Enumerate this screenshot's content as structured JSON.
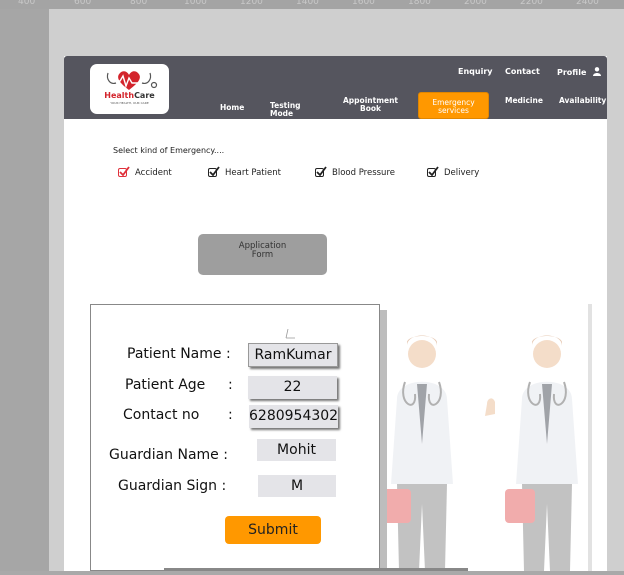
{
  "ruler": [
    "400",
    "600",
    "800",
    "1000",
    "1200",
    "1400",
    "1600",
    "1800",
    "2000",
    "2200",
    "2400"
  ],
  "logo": {
    "brand_red": "Health",
    "brand_dark": "Care",
    "tagline": "YOUR HEALTH, OUR CARE"
  },
  "nav_top": {
    "enquiry": "Enquiry",
    "contact": "Contact",
    "profile": "Profile"
  },
  "nav": {
    "home": "Home",
    "testing_1": "Testing",
    "testing_2": "Mode",
    "appointment_1": "Appointment",
    "appointment_2": "Book",
    "emergency_1": "Emergency",
    "emergency_2": "services",
    "medicine": "Medicine",
    "availability": "Availability"
  },
  "emergency": {
    "prompt": "Select kind of Emergency....",
    "options": [
      "Accident",
      "Heart Patient",
      "Blood Pressure",
      "Delivery"
    ]
  },
  "app_form": {
    "line1": "Application",
    "line2": "Form"
  },
  "form": {
    "patient_name_label": "Patient Name :",
    "patient_name": "RamKumar",
    "patient_age_label": "Patient Age",
    "patient_age": "22",
    "contact_label": "Contact no",
    "contact": "6280954302",
    "colon": ":",
    "guardian_name_label": "Guardian Name :",
    "guardian_name": "Mohit",
    "guardian_sign_label": "Guardian Sign :",
    "guardian_sign": "M",
    "submit": "Submit"
  },
  "colors": {
    "navbar": "#55555e",
    "accent": "#ff9800",
    "brand": "#d3242c"
  }
}
